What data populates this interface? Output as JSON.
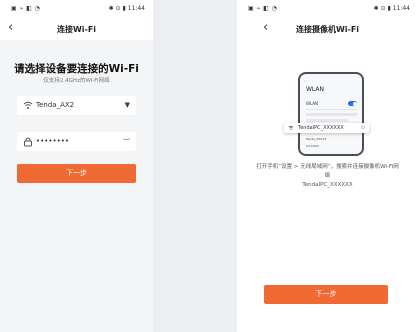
{
  "left": {
    "status": {
      "left": "▣ ⌁ ◧ ◔",
      "right": "✱ ⊙ ▮ 11:44"
    },
    "nav": {
      "back": "‹",
      "title": "连接Wi-Fi"
    },
    "heading": "请选择设备要连接的Wi-Fi",
    "subheading": "仅支持2.4GHz的Wi-Fi网络",
    "wifi_field": {
      "value": "Tenda_AX2",
      "icon": "wifi-icon",
      "arrow": "▼"
    },
    "password_field": {
      "value": "••••••••",
      "icon": "lock-icon",
      "toggle": "︶"
    },
    "next_button": "下一步"
  },
  "right": {
    "status": {
      "left": "▣ ⌁ ◧ ◔",
      "right": "✱ ⊙ ▮ 11:44"
    },
    "nav": {
      "back": "‹",
      "title": "连接摄像机Wi-Fi"
    },
    "phone_screen": {
      "wlan_title": "WLAN",
      "wlan_label": "WLAN",
      "net1": "Tenda_XXXXX",
      "net2": "24.XXXX",
      "tip_ssid": "TendaIPC_XXXXXX"
    },
    "instruction_line1": "打开手机“设置 > 无线局域网”，搜索并连接摄像机Wi-Fi网络",
    "instruction_line2": "TendaIPC_XXXXXX",
    "next_button": "下一步"
  },
  "colors": {
    "accent": "#f06a34",
    "toggle": "#2a6ef5"
  }
}
